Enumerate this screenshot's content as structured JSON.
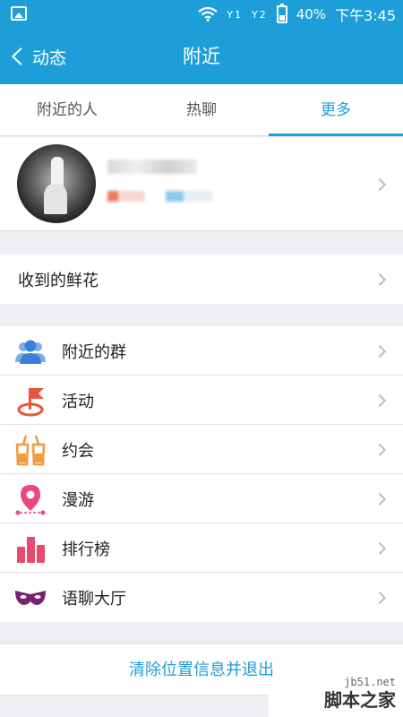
{
  "status_bar": {
    "icons": [
      "image-icon",
      "wifi-icon",
      "signal-1-icon",
      "signal-2-icon",
      "battery-icon"
    ],
    "signal_1": "Y1",
    "signal_2": "Y2",
    "battery": "40%",
    "time": "下午3:45"
  },
  "nav": {
    "back_label": "动态",
    "title": "附近"
  },
  "tabs": [
    {
      "label": "附近的人",
      "active": false
    },
    {
      "label": "热聊",
      "active": false
    },
    {
      "label": "更多",
      "active": true
    }
  ],
  "profile": {
    "avatar": "avatar-photo"
  },
  "rows": {
    "flowers": "收到的鲜花",
    "nearby_groups": "附近的群",
    "activities": "活动",
    "dates": "约会",
    "roaming": "漫游",
    "ranking": "排行榜",
    "voice_hall": "语聊大厅"
  },
  "icons": {
    "nearby_groups": "group-icon",
    "activities": "flag-icon",
    "dates": "drinks-icon",
    "roaming": "location-pin-icon",
    "ranking": "bar-chart-icon",
    "voice_hall": "mask-icon"
  },
  "colors": {
    "accent": "#1e9ed8",
    "group_icon": "#3b7fd8",
    "flag_icon": "#e8553c",
    "drinks_icon": "#f29a3c",
    "pin_icon": "#e84a7a",
    "chart_icon": "#e84a6c",
    "mask_icon": "#7a2270"
  },
  "footer": {
    "exit_label": "清除位置信息并退出"
  },
  "watermark": {
    "url": "jb51.net",
    "text": "脚本之家"
  }
}
